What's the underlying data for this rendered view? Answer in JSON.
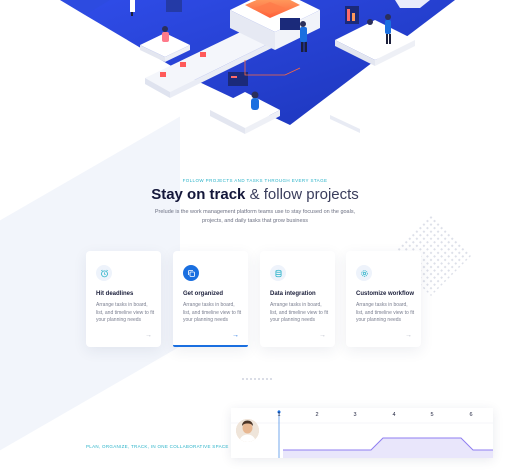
{
  "section": {
    "eyebrow": "FOLLOW PROJECTS AND TASKS THROUGH EVERY STAGE",
    "title_bold": "Stay on track",
    "title_rest": " & follow projects",
    "subtitle": "Prelude is the work management platform teams use to stay focused on the goals, projects, and daily tasks that grow business"
  },
  "cards": [
    {
      "title": "Hit deadlines",
      "desc": "Arrange tasks in board, list, and timeline view to fit your planning needs",
      "icon": "alarm-clock-icon",
      "active": false
    },
    {
      "title": "Get organized",
      "desc": "Arrange tasks in board, list, and timeline view to fit your planning needs",
      "icon": "copy-icon",
      "active": true
    },
    {
      "title": "Data integration",
      "desc": "Arrange tasks in board, list, and timeline view to fit your planning needs",
      "icon": "database-icon",
      "active": false
    },
    {
      "title": "Customize workflow",
      "desc": "Arrange tasks in board, list, and timeline view to fit your planning needs",
      "icon": "settings-icon",
      "active": false
    }
  ],
  "card_arrow": "→",
  "next_section": {
    "eyebrow": "PLAN, ORGANIZE, TRACK, IN ONE COLLABORATIVE SPACE"
  },
  "timeline": {
    "columns": [
      "1",
      "2",
      "3",
      "4",
      "5",
      "6"
    ]
  },
  "colors": {
    "accent": "#1a6fe0",
    "teal": "#2bb3c9",
    "hero_blue": "#1f3fd6",
    "orange": "#ff6a3d"
  }
}
